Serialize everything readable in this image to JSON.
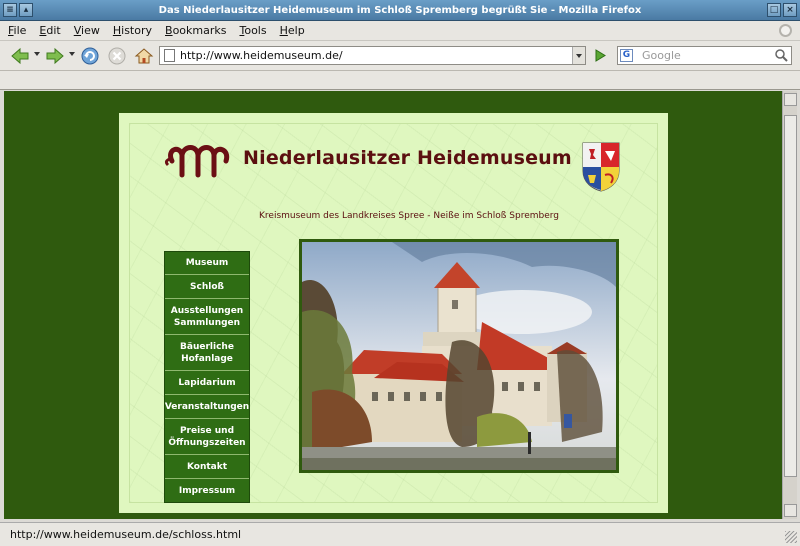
{
  "window": {
    "title": "Das Niederlausitzer Heidemuseum im Schloß Spremberg begrüßt Sie - Mozilla Firefox"
  },
  "menu": [
    "File",
    "Edit",
    "View",
    "History",
    "Bookmarks",
    "Tools",
    "Help"
  ],
  "toolbar": {
    "url": "http://www.heidemuseum.de/",
    "search_placeholder": "Google"
  },
  "site": {
    "title": "Niederlausitzer Heidemuseum",
    "subtitle": "Kreismuseum des Landkreises Spree - Neiße im Schloß Spremberg",
    "nav": [
      {
        "label": "Museum"
      },
      {
        "label": "Schloß"
      },
      {
        "label": "Ausstellungen\nSammlungen"
      },
      {
        "label": "Bäuerliche\nHofanlage"
      },
      {
        "label": "Lapidarium"
      },
      {
        "label": "Veranstaltungen"
      },
      {
        "label": "Preise und\nÖffnungszeiten"
      },
      {
        "label": "Kontakt"
      },
      {
        "label": "Impressum"
      }
    ]
  },
  "status": {
    "text": "http://www.heidemuseum.de/schloss.html"
  },
  "colors": {
    "page_bg": "#2f5a0e",
    "panel": "#dff7bf",
    "title": "#5b0f10",
    "nav_bg": "#2f6d14"
  }
}
